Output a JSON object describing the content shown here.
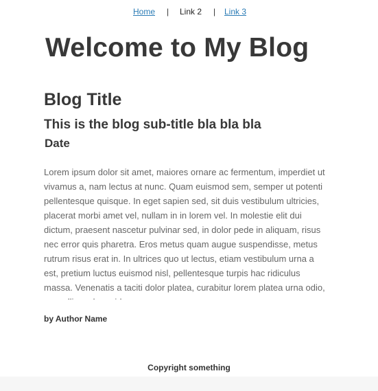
{
  "nav": {
    "links": [
      {
        "label": "Home",
        "current": false
      },
      {
        "label": "Link 2",
        "current": true
      },
      {
        "label": "Link 3",
        "current": false
      }
    ],
    "separator": "|"
  },
  "site": {
    "title": "Welcome to My Blog"
  },
  "post": {
    "title": "Blog Title",
    "subtitle": "This is the blog sub-title bla bla bla",
    "date": "Date",
    "body": "Lorem ipsum dolor sit amet, maiores ornare ac fermentum, imperdiet ut vivamus a, nam lectus at nunc. Quam euismod sem, semper ut potenti pellentesque quisque. In eget sapien sed, sit duis vestibulum ultricies, placerat morbi amet vel, nullam in in lorem vel. In molestie elit dui dictum, praesent nascetur pulvinar sed, in dolor pede in aliquam, risus nec error quis pharetra. Eros metus quam augue suspendisse, metus rutrum risus erat in.  In ultrices quo ut lectus, etiam vestibulum urna a est, pretium luctus euismod nisl, pellentesque turpis hac ridiculus massa. Venenatis a taciti dolor platea, curabitur lorem platea urna odio, convallis sed gravida.",
    "author": "by Author Name"
  },
  "footer": {
    "copyright": "Copyright something"
  },
  "colors": {
    "link": "#2a7bb5",
    "heading": "#383838",
    "body_text": "#666666"
  }
}
